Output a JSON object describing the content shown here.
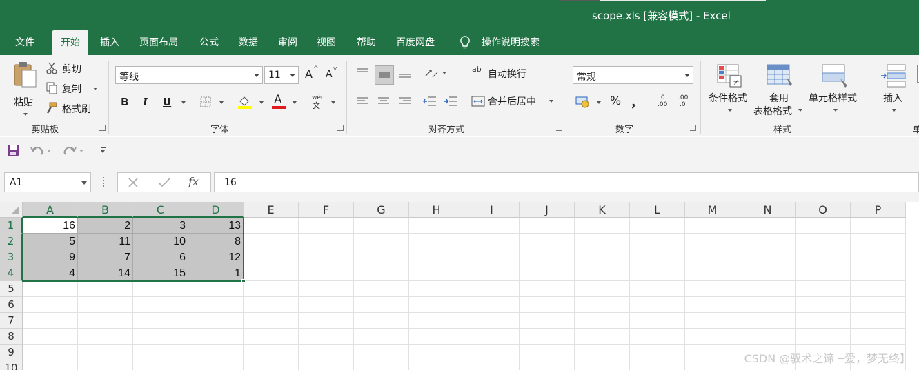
{
  "window": {
    "title": "scope.xls  [兼容模式]  -  Excel"
  },
  "tabs": [
    {
      "label": "文件"
    },
    {
      "label": "开始",
      "active": true
    },
    {
      "label": "插入"
    },
    {
      "label": "页面布局"
    },
    {
      "label": "公式"
    },
    {
      "label": "数据"
    },
    {
      "label": "审阅"
    },
    {
      "label": "视图"
    },
    {
      "label": "帮助"
    },
    {
      "label": "百度网盘"
    },
    {
      "label": "操作说明搜索",
      "icon": "lightbulb-icon"
    }
  ],
  "ribbon": {
    "clipboard": {
      "paste_label": "粘贴",
      "cut_label": "剪切",
      "copy_label": "复制",
      "format_painter_label": "格式刷",
      "group_label": "剪贴板"
    },
    "font": {
      "font_name": "等线",
      "font_size": "11",
      "grow_label": "A",
      "shrink_label": "A",
      "bold_label": "B",
      "italic_label": "I",
      "underline_label": "U",
      "font_color_label": "A",
      "phonetic_label": "wén",
      "phonetic_sub": "文",
      "group_label": "字体"
    },
    "alignment": {
      "wrap_label": "自动换行",
      "wrap_icon_text": "ab",
      "merge_label": "合并后居中",
      "group_label": "对齐方式"
    },
    "number": {
      "format_value": "常规",
      "percent_label": "%",
      "comma_label": "，",
      "inc_decimal_label": ".0",
      "dec_decimal_label": ".00",
      "group_label": "数字"
    },
    "styles": {
      "conditional_label": "条件格式",
      "table_label_1": "套用",
      "table_label_2": "表格格式",
      "cell_styles_label": "单元格样式",
      "group_label": "样式"
    },
    "cells": {
      "insert_label": "插入",
      "partial_label": "单"
    }
  },
  "formula_bar": {
    "name_box": "A1",
    "fx_label": "fx",
    "content": "16"
  },
  "sheet": {
    "columns": [
      "A",
      "B",
      "C",
      "D",
      "E",
      "F",
      "G",
      "H",
      "I",
      "J",
      "K",
      "L",
      "M",
      "N",
      "O",
      "P"
    ],
    "rows": [
      "1",
      "2",
      "3",
      "4",
      "5",
      "6",
      "7",
      "8",
      "9",
      "10"
    ],
    "data": [
      [
        "16",
        "2",
        "3",
        "13"
      ],
      [
        "5",
        "11",
        "10",
        "8"
      ],
      [
        "9",
        "7",
        "6",
        "12"
      ],
      [
        "4",
        "14",
        "15",
        "1"
      ]
    ],
    "selection": "A1:D4",
    "active_cell": "A1"
  },
  "watermark": "CSDN @驭术之谛 ─爱，梦无终】",
  "colors": {
    "brand": "#217346",
    "ribbon_bg": "#f3f3f3",
    "selection_fill": "#c6c6c6"
  }
}
